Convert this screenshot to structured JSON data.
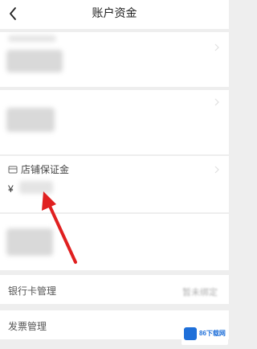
{
  "header": {
    "title": "账户资金",
    "back_icon": "chevron-left-icon"
  },
  "deposit": {
    "label": "店铺保证金",
    "currency_symbol": "¥",
    "icon": "card-icon"
  },
  "rows": {
    "bank_card": {
      "label": "银行卡管理",
      "value": "暂未绑定"
    },
    "invoice": {
      "label": "发票管理"
    }
  },
  "watermark": {
    "text": "86下载网"
  },
  "colors": {
    "arrow": "#e02020",
    "background": "#eeeeee",
    "card": "#ffffff"
  }
}
